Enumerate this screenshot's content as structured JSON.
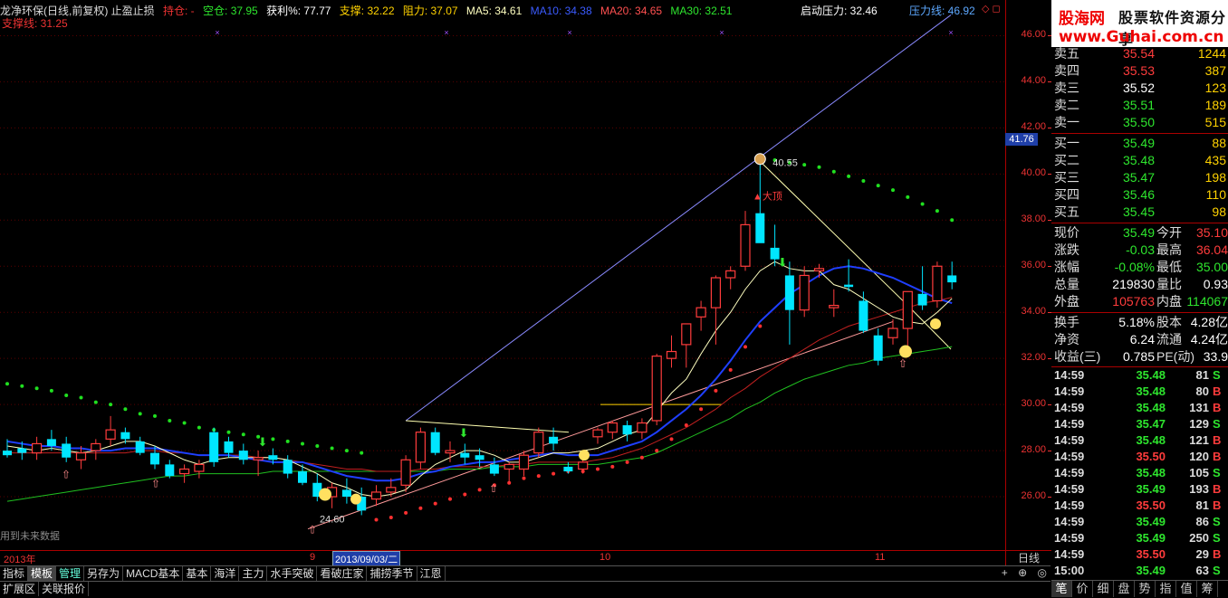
{
  "header": {
    "title": "龙净环保(日线,前复权) 止盈止损",
    "hold_label": "持仓: -",
    "empty_label": "空仓: 37.95",
    "profit_label": "获利%: 77.77",
    "support_label": "支撑: 32.22",
    "resist_label": "阻力: 37.07",
    "ma5": "MA5: 34.61",
    "ma10": "MA10: 34.38",
    "ma20": "MA20: 34.65",
    "ma30": "MA30: 32.51",
    "start_pressure": "启动压力: 32.46",
    "pressure_line": "压力线: 46.92",
    "support_line": "支撑线: 31.25",
    "future_note": "用到未来数据"
  },
  "colors": {
    "up": "#ff3c3c",
    "down": "#00e5ff",
    "ma5": "#ffffc0",
    "ma10": "#1f3fff",
    "ma20": "#c02020",
    "ma30": "#20c020"
  },
  "chart_data": {
    "type": "candlestick",
    "ylim": [
      24,
      47
    ],
    "y_ticks": [
      "46.00",
      "44.00",
      "42.00",
      "40.00",
      "38.00",
      "36.00",
      "34.00",
      "32.00",
      "30.00",
      "28.00",
      "26.00"
    ],
    "current_price_label": "41.76",
    "x_labels": [
      "2013年",
      "9",
      "2013/09/03/二",
      "10",
      "11"
    ],
    "annotations": {
      "high": "40.55",
      "low": "24.60",
      "top_mark": "大顶"
    },
    "candles": [
      [
        28.0,
        28.5,
        27.7,
        27.8
      ],
      [
        28.1,
        28.4,
        27.6,
        27.9
      ],
      [
        27.9,
        28.6,
        27.6,
        28.3
      ],
      [
        28.5,
        28.9,
        28.0,
        28.2
      ],
      [
        28.3,
        28.6,
        27.5,
        27.7
      ],
      [
        27.6,
        28.2,
        27.2,
        27.9
      ],
      [
        28.0,
        28.5,
        27.6,
        28.3
      ],
      [
        28.5,
        29.5,
        28.2,
        28.9
      ],
      [
        28.8,
        29.0,
        28.3,
        28.5
      ],
      [
        28.4,
        28.6,
        27.8,
        27.9
      ],
      [
        27.9,
        28.2,
        27.2,
        27.4
      ],
      [
        27.4,
        27.6,
        26.8,
        26.9
      ],
      [
        27.0,
        27.4,
        26.6,
        27.2
      ],
      [
        27.1,
        27.6,
        26.8,
        27.4
      ],
      [
        28.8,
        29.0,
        27.3,
        27.5
      ],
      [
        28.4,
        28.6,
        27.7,
        27.9
      ],
      [
        28.0,
        28.3,
        27.4,
        27.6
      ],
      [
        27.6,
        28.0,
        26.9,
        27.7
      ],
      [
        27.8,
        28.1,
        27.4,
        27.6
      ],
      [
        27.6,
        27.8,
        26.8,
        27.0
      ],
      [
        27.1,
        27.4,
        26.5,
        26.6
      ],
      [
        26.6,
        27.0,
        25.8,
        26.0
      ],
      [
        26.0,
        26.6,
        25.5,
        26.4
      ],
      [
        26.3,
        26.8,
        25.7,
        26.0
      ],
      [
        26.0,
        26.4,
        25.2,
        25.4
      ],
      [
        25.9,
        26.5,
        25.6,
        26.2
      ],
      [
        26.2,
        26.8,
        26.0,
        26.4
      ],
      [
        26.5,
        27.8,
        26.2,
        27.6
      ],
      [
        27.5,
        29.0,
        27.2,
        28.8
      ],
      [
        28.8,
        29.0,
        27.8,
        27.9
      ],
      [
        27.9,
        28.4,
        27.5,
        28.0
      ],
      [
        27.9,
        28.3,
        27.4,
        27.7
      ],
      [
        27.8,
        28.1,
        27.3,
        27.6
      ],
      [
        27.4,
        27.7,
        26.9,
        27.0
      ],
      [
        27.2,
        27.5,
        26.6,
        27.4
      ],
      [
        27.2,
        28.0,
        26.9,
        27.8
      ],
      [
        27.9,
        29.0,
        27.7,
        28.8
      ],
      [
        28.6,
        29.0,
        28.0,
        28.3
      ],
      [
        27.3,
        27.5,
        27.0,
        27.1
      ],
      [
        27.2,
        27.7,
        27.0,
        27.5
      ],
      [
        28.6,
        29.0,
        28.3,
        28.9
      ],
      [
        28.8,
        29.3,
        28.5,
        29.2
      ],
      [
        29.1,
        29.3,
        28.4,
        28.7
      ],
      [
        28.8,
        29.4,
        28.5,
        29.2
      ],
      [
        29.3,
        32.2,
        29.1,
        32.1
      ],
      [
        32.0,
        33.0,
        31.6,
        32.3
      ],
      [
        32.6,
        33.4,
        31.6,
        33.5
      ],
      [
        33.8,
        34.5,
        33.2,
        34.2
      ],
      [
        34.2,
        35.6,
        32.6,
        35.5
      ],
      [
        35.5,
        36.0,
        35.0,
        35.8
      ],
      [
        36.0,
        38.4,
        35.8,
        37.8
      ],
      [
        38.3,
        40.5,
        37.4,
        37.0
      ],
      [
        36.8,
        37.8,
        36.0,
        36.3
      ],
      [
        35.6,
        36.2,
        32.6,
        34.1
      ],
      [
        34.1,
        36.0,
        33.8,
        35.6
      ],
      [
        35.8,
        36.1,
        35.5,
        35.9
      ],
      [
        34.2,
        35.0,
        33.8,
        34.3
      ],
      [
        35.2,
        36.3,
        34.9,
        35.1
      ],
      [
        34.5,
        34.9,
        33.1,
        33.2
      ],
      [
        33.0,
        33.3,
        31.7,
        31.9
      ],
      [
        32.9,
        33.7,
        32.6,
        33.3
      ],
      [
        33.3,
        34.7,
        32.3,
        34.9
      ],
      [
        34.8,
        36.0,
        34.1,
        34.3
      ],
      [
        34.5,
        36.2,
        34.2,
        36.0
      ],
      [
        35.6,
        36.2,
        35.0,
        35.3
      ]
    ],
    "ma5": [
      28.2,
      28.1,
      28.0,
      28.1,
      28.0,
      27.9,
      28.0,
      28.2,
      28.4,
      28.4,
      28.2,
      27.9,
      27.6,
      27.4,
      27.6,
      27.7,
      27.7,
      27.7,
      27.7,
      27.6,
      27.3,
      27.0,
      26.6,
      26.4,
      26.1,
      26.0,
      26.1,
      26.3,
      26.9,
      27.4,
      27.7,
      28.0,
      28.0,
      27.8,
      27.5,
      27.5,
      27.7,
      27.9,
      27.9,
      28.0,
      28.1,
      28.4,
      28.7,
      28.9,
      29.7,
      30.5,
      31.1,
      32.2,
      33.2,
      34.0,
      35.0,
      35.8,
      36.2,
      35.9,
      35.8,
      35.8,
      35.2,
      35.0,
      34.6,
      34.2,
      33.8,
      33.6,
      33.5,
      34.0,
      34.6
    ],
    "ma10": [
      28.4,
      28.3,
      28.2,
      28.2,
      28.1,
      28.1,
      28.0,
      28.0,
      28.1,
      28.1,
      28.1,
      28.0,
      27.9,
      27.8,
      27.8,
      27.8,
      27.7,
      27.6,
      27.5,
      27.5,
      27.5,
      27.3,
      27.1,
      26.9,
      26.8,
      26.7,
      26.7,
      26.8,
      27.0,
      27.1,
      27.3,
      27.4,
      27.5,
      27.5,
      27.6,
      27.7,
      27.8,
      27.9,
      27.8,
      27.8,
      27.8,
      28.0,
      28.2,
      28.4,
      28.8,
      29.3,
      29.8,
      30.4,
      31.1,
      31.9,
      32.8,
      33.6,
      34.2,
      34.8,
      35.2,
      35.6,
      35.9,
      36.0,
      35.9,
      35.7,
      35.5,
      35.2,
      34.9,
      34.6,
      34.4
    ],
    "ma20": [
      27.9,
      27.9,
      27.9,
      27.9,
      27.9,
      27.9,
      27.9,
      27.9,
      27.9,
      28.0,
      28.0,
      27.9,
      27.9,
      27.8,
      27.8,
      27.8,
      27.8,
      27.7,
      27.7,
      27.6,
      27.5,
      27.4,
      27.3,
      27.2,
      27.2,
      27.1,
      27.1,
      27.1,
      27.2,
      27.2,
      27.3,
      27.3,
      27.3,
      27.3,
      27.4,
      27.4,
      27.5,
      27.5,
      27.5,
      27.5,
      27.6,
      27.7,
      27.9,
      28.1,
      28.4,
      28.7,
      29.0,
      29.4,
      29.8,
      30.3,
      30.7,
      31.2,
      31.6,
      32.0,
      32.4,
      32.8,
      33.1,
      33.4,
      33.6,
      33.8,
      34.0,
      34.2,
      34.4,
      34.5,
      34.65
    ],
    "ma30": [
      25.8,
      25.9,
      26.0,
      26.1,
      26.2,
      26.3,
      26.4,
      26.5,
      26.6,
      26.7,
      26.8,
      26.9,
      26.9,
      27.0,
      27.0,
      27.0,
      27.0,
      27.0,
      27.1,
      27.1,
      27.1,
      27.1,
      27.1,
      27.1,
      27.1,
      27.1,
      27.1,
      27.1,
      27.1,
      27.1,
      27.2,
      27.2,
      27.2,
      27.3,
      27.3,
      27.3,
      27.4,
      27.4,
      27.4,
      27.4,
      27.4,
      27.5,
      27.6,
      27.7,
      27.9,
      28.2,
      28.5,
      28.8,
      29.1,
      29.4,
      29.8,
      30.1,
      30.5,
      30.8,
      31.1,
      31.3,
      31.5,
      31.7,
      31.8,
      32.0,
      32.1,
      32.2,
      32.3,
      32.4,
      32.51
    ],
    "sar_dots": [
      30.9,
      30.8,
      30.7,
      30.6,
      30.4,
      30.3,
      30.1,
      30.0,
      29.8,
      29.6,
      29.5,
      29.3,
      29.2,
      29.0,
      28.9,
      28.8,
      28.7,
      28.6,
      28.5,
      28.4,
      28.3,
      28.2,
      28.1,
      28.0,
      27.9,
      25.0,
      25.1,
      25.3,
      25.5,
      25.7,
      25.9,
      26.1,
      26.3,
      26.5,
      26.6,
      26.8,
      26.9,
      27.0,
      27.1,
      27.1,
      27.2,
      27.3,
      27.5,
      27.7,
      28.0,
      28.5,
      29.1,
      29.8,
      30.6,
      31.5,
      32.5,
      33.4,
      40.6,
      40.5,
      40.4,
      40.3,
      40.1,
      39.9,
      39.7,
      39.5,
      39.3,
      39.0,
      38.7,
      38.4,
      38.0
    ]
  },
  "price_axis_label": "日线",
  "tabs": [
    "指标",
    "模板",
    "管理",
    "另存为",
    "MACD基本",
    "基本",
    "海洋",
    "主力",
    "水手突破",
    "看破庄家",
    "捕捞季节",
    "江恩"
  ],
  "tab_tools": [
    "+",
    "⊕",
    "◎"
  ],
  "subtabs": [
    "扩展区",
    "关联报价"
  ],
  "logo": {
    "cn": "股海网",
    "tagline": "股票软件资源分享",
    "url": "www.Guhai.com.cn"
  },
  "quotes": {
    "asks": [
      {
        "label": "卖五",
        "price": "35.54",
        "vol": "1244"
      },
      {
        "label": "卖四",
        "price": "35.53",
        "vol": "387"
      },
      {
        "label": "卖三",
        "price": "35.52",
        "vol": "123"
      },
      {
        "label": "卖二",
        "price": "35.51",
        "vol": "189"
      },
      {
        "label": "卖一",
        "price": "35.50",
        "vol": "515"
      }
    ],
    "bids": [
      {
        "label": "买一",
        "price": "35.49",
        "vol": "88"
      },
      {
        "label": "买二",
        "price": "35.48",
        "vol": "435"
      },
      {
        "label": "买三",
        "price": "35.47",
        "vol": "198"
      },
      {
        "label": "买四",
        "price": "35.46",
        "vol": "110"
      },
      {
        "label": "买五",
        "price": "35.45",
        "vol": "98"
      }
    ]
  },
  "stats": [
    {
      "l1": "现价",
      "v1": "35.49",
      "c1": "green",
      "l2": "今开",
      "v2": "35.10",
      "c2": "red"
    },
    {
      "l1": "涨跌",
      "v1": "-0.03",
      "c1": "green",
      "l2": "最高",
      "v2": "36.04",
      "c2": "red"
    },
    {
      "l1": "涨幅",
      "v1": "-0.08%",
      "c1": "green",
      "l2": "最低",
      "v2": "35.00",
      "c2": "green"
    },
    {
      "l1": "总量",
      "v1": "219830",
      "c1": "white",
      "l2": "量比",
      "v2": "0.93",
      "c2": "white"
    },
    {
      "l1": "外盘",
      "v1": "105763",
      "c1": "red",
      "l2": "内盘",
      "v2": "114067",
      "c2": "green"
    }
  ],
  "fundamentals": [
    {
      "l1": "换手",
      "v1": "5.18%",
      "l2": "股本",
      "v2": "4.28亿"
    },
    {
      "l1": "净资",
      "v1": "6.24",
      "l2": "流通",
      "v2": "4.24亿"
    },
    {
      "l1": "收益(三)",
      "v1": "0.785",
      "l2": "PE(动)",
      "v2": "33.9"
    }
  ],
  "ticks": [
    {
      "t": "14:59",
      "p": "35.48",
      "v": "81",
      "bs": "S",
      "c": "green"
    },
    {
      "t": "14:59",
      "p": "35.48",
      "v": "80",
      "bs": "B",
      "c": "green"
    },
    {
      "t": "14:59",
      "p": "35.48",
      "v": "131",
      "bs": "B",
      "c": "green"
    },
    {
      "t": "14:59",
      "p": "35.47",
      "v": "129",
      "bs": "S",
      "c": "green"
    },
    {
      "t": "14:59",
      "p": "35.48",
      "v": "121",
      "bs": "B",
      "c": "green"
    },
    {
      "t": "14:59",
      "p": "35.50",
      "v": "120",
      "bs": "B",
      "c": "red"
    },
    {
      "t": "14:59",
      "p": "35.48",
      "v": "105",
      "bs": "S",
      "c": "green"
    },
    {
      "t": "14:59",
      "p": "35.49",
      "v": "193",
      "bs": "B",
      "c": "green"
    },
    {
      "t": "14:59",
      "p": "35.50",
      "v": "81",
      "bs": "B",
      "c": "red"
    },
    {
      "t": "14:59",
      "p": "35.49",
      "v": "86",
      "bs": "S",
      "c": "green"
    },
    {
      "t": "14:59",
      "p": "35.49",
      "v": "250",
      "bs": "S",
      "c": "green"
    },
    {
      "t": "14:59",
      "p": "35.50",
      "v": "29",
      "bs": "B",
      "c": "red"
    },
    {
      "t": "15:00",
      "p": "35.49",
      "v": "63",
      "bs": "S",
      "c": "green"
    }
  ],
  "bottom_tabs": [
    "笔",
    "价",
    "细",
    "盘",
    "势",
    "指",
    "值",
    "筹"
  ]
}
